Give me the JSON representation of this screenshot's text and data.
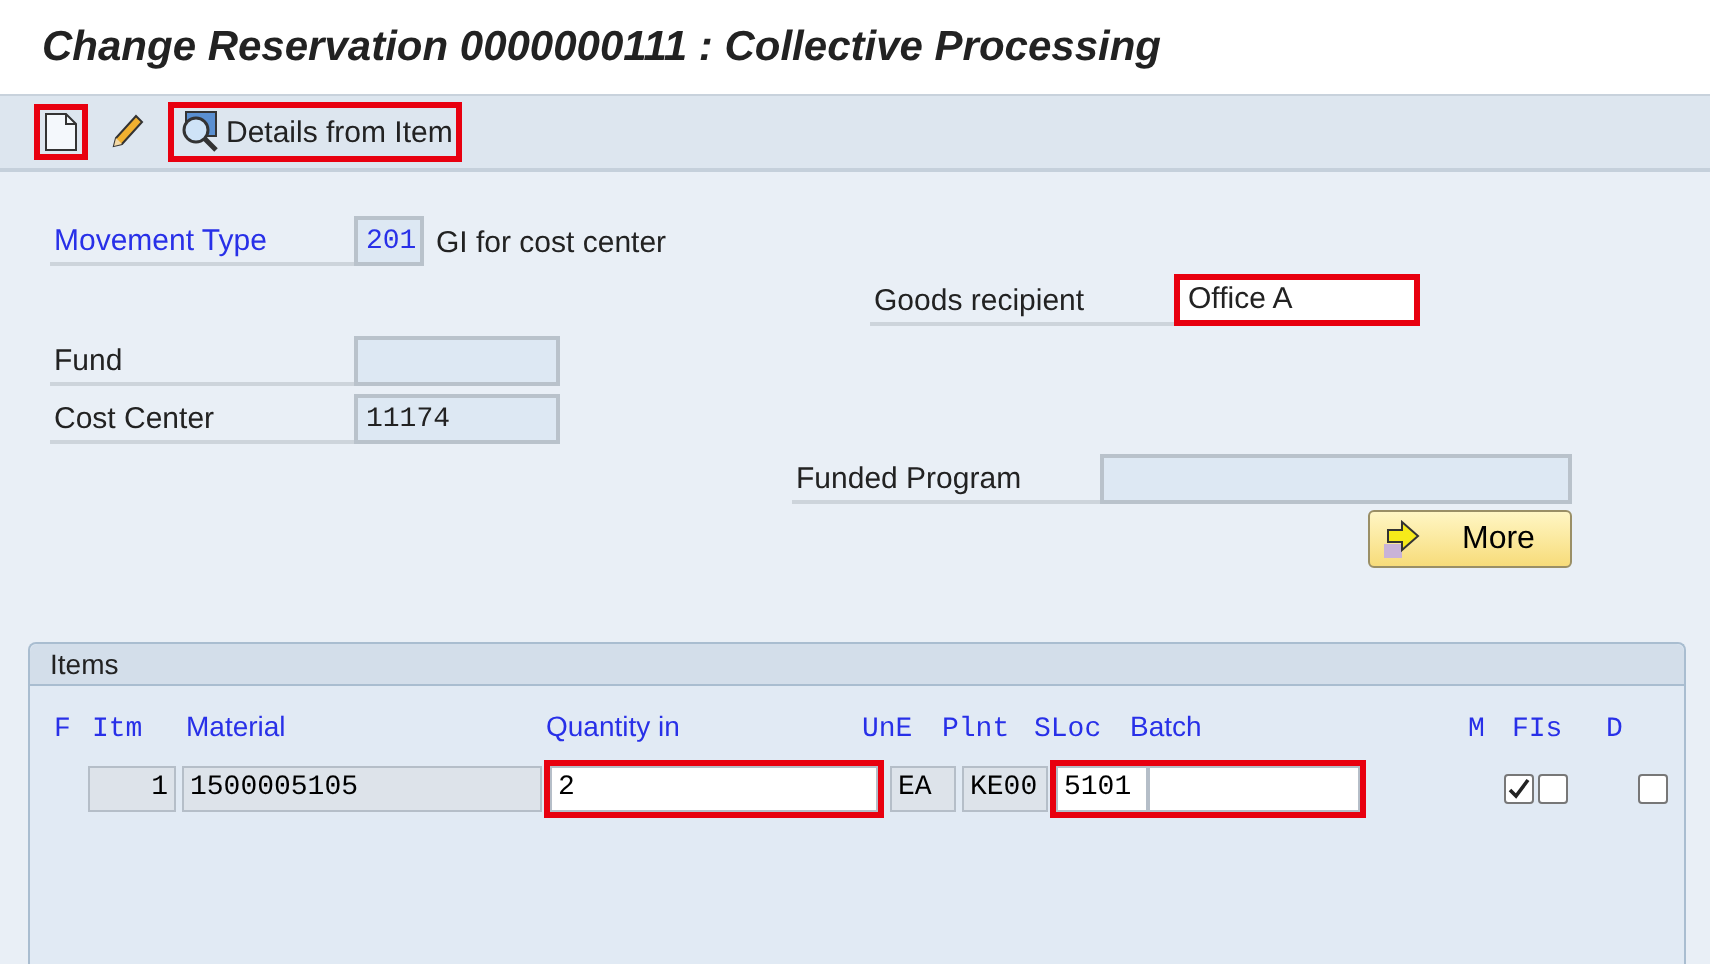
{
  "window": {
    "title": "Change Reservation 0000000111 : Collective Processing"
  },
  "toolbar": [
    {
      "kind": "create",
      "highlighted": true
    },
    {
      "kind": "edit",
      "highlighted": false
    },
    {
      "kind": "details",
      "label": "Details from Item",
      "highlighted": true
    }
  ],
  "header": {
    "movement_type": {
      "label": "Movement Type",
      "value": "201",
      "description": "GI for cost center"
    },
    "goods_recipient": {
      "label": "Goods recipient",
      "value": "Office A",
      "highlighted": true
    },
    "fund": {
      "label": "Fund"
    },
    "cost_center": {
      "label": "Cost Center",
      "value": "11174"
    },
    "funded_program": {
      "label": "Funded Program"
    },
    "more_button": {
      "label": "More"
    }
  },
  "items": {
    "title": "Items",
    "columns": [
      "F",
      "Itm",
      "Material",
      "Quantity in",
      "UnE",
      "Plnt",
      "SLoc",
      "Batch",
      "M",
      "FIs",
      "D"
    ],
    "rows": [
      {
        "cells": [
          {
            "kind": "status"
          },
          {
            "kind": "text",
            "value": "1",
            "highlighted": false
          },
          {
            "kind": "text",
            "value": "1500005105",
            "highlighted": false
          },
          {
            "kind": "text",
            "value": "2",
            "highlighted": true
          },
          {
            "kind": "text",
            "value": "EA",
            "highlighted": false
          },
          {
            "kind": "text",
            "value": "KE00",
            "highlighted": false
          },
          {
            "kind": "text",
            "value": "5101",
            "highlighted": true
          },
          {
            "kind": "text",
            "highlighted": true
          },
          {
            "kind": "checkbox",
            "checked": true
          },
          {
            "kind": "checkbox",
            "checked": false
          },
          {
            "kind": "checkbox",
            "checked": false
          }
        ]
      }
    ]
  }
}
